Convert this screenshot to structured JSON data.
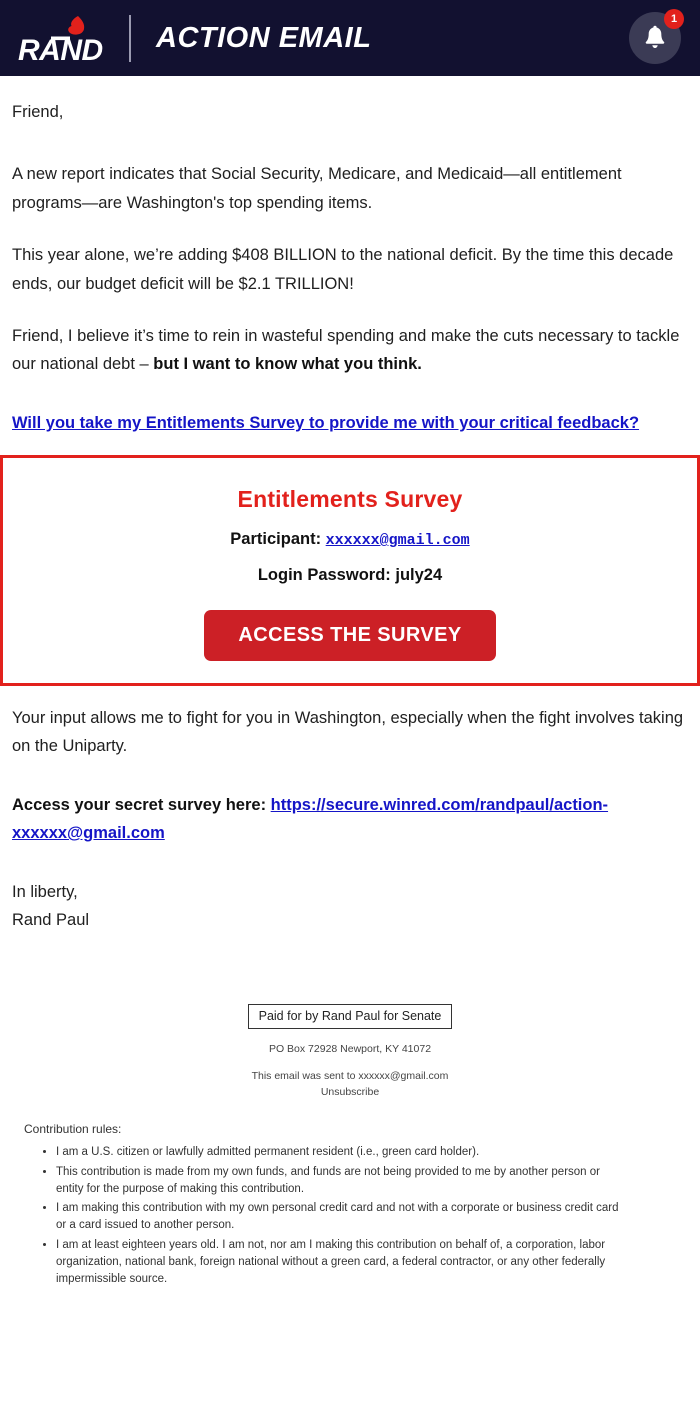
{
  "header": {
    "logo_text": "RAND",
    "logo_icon": "flame-icon",
    "title": "ACTION EMAIL",
    "notification_icon": "bell-icon",
    "notification_count": "1",
    "background_color": "#121130",
    "badge_color": "#e2211c"
  },
  "body": {
    "greeting": "Friend,",
    "paragraph_1": "A new report indicates that Social Security, Medicare, and Medicaid—all entitlement programs—are Washington's top spending items.",
    "paragraph_2": "This year alone, we’re adding $408 BILLION to the national deficit. By the time this decade ends, our budget deficit will be $2.1 TRILLION!",
    "paragraph_3_plain": "Friend, I believe it’s time to rein in wasteful spending and make the cuts necessary to tackle our national debt – ",
    "paragraph_3_bold": "but I want to know what you think.",
    "survey_link_text": "Will you take my Entitlements Survey to provide me with your critical feedback?",
    "paragraph_4": "Your input allows me to fight for you in Washington, especially when the fight involves taking on the Uniparty.",
    "secret_label": "Access your secret survey here: ",
    "secret_url": "https://secure.winred.com/randpaul/action-xxxxxx@gmail.com",
    "signoff": "In liberty,",
    "signature": "Rand Paul"
  },
  "survey_box": {
    "title": "Entitlements Survey",
    "participant_label": "Participant: ",
    "participant_email": "xxxxxx@gmail.com",
    "password_line": "Login Password: july24",
    "button_label": "ACCESS THE SURVEY",
    "border_color": "#e2211c",
    "title_color": "#e2211c",
    "button_color": "#cc2026"
  },
  "footer": {
    "paid_for": "Paid for by Rand Paul for Senate",
    "address": "PO Box 72928 Newport, KY 41072",
    "sent_to": "This email was sent to xxxxxx@gmail.com",
    "unsubscribe": "Unsubscribe",
    "rules_heading": "Contribution rules:",
    "rules": [
      "I am a U.S. citizen or lawfully admitted permanent resident (i.e., green card holder).",
      "This contribution is made from my own funds, and funds are not being provided to me by another person or entity for the purpose of making this contribution.",
      "I am making this contribution with my own personal credit card and not with a corporate or business credit card or a card issued to another person.",
      "I am at least eighteen years old. I am not, nor am I making this contribution on behalf of, a corporation, labor organization, national bank, foreign national without a green card, a federal contractor, or any other federally impermissible source."
    ]
  }
}
